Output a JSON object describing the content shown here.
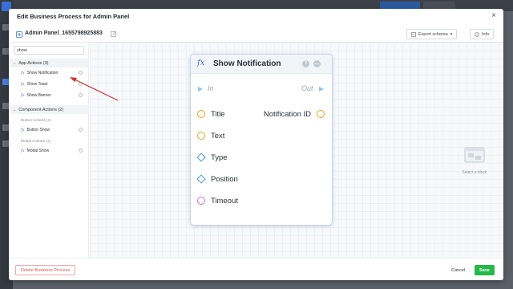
{
  "modal": {
    "title": "Edit Business Process for Admin Panel",
    "close_icon": "×"
  },
  "subheader": {
    "process_name": "Admin Panel_1655798925883",
    "export_label": "Export schema",
    "info_label": "Info"
  },
  "search": {
    "value": "show"
  },
  "left_panel": {
    "app_actions": {
      "label": "App Actions (3)",
      "items": [
        "Show Notification",
        "Show Toast",
        "Show Banner"
      ]
    },
    "component_actions": {
      "label": "Component Actions (2)",
      "button_actions_label": "Button Actions (1)",
      "button_items": [
        "Button Show"
      ],
      "modal_actions_label": "Modal Actions (1)",
      "modal_items": [
        "Modal Show"
      ]
    }
  },
  "node": {
    "fx": "fx",
    "title": "Show Notification",
    "in_label": "In",
    "out_label": "Out",
    "inputs": [
      {
        "label": "Title",
        "shape": "circle",
        "color": "#e5a31a"
      },
      {
        "label": "Text",
        "shape": "circle",
        "color": "#e5a31a"
      },
      {
        "label": "Type",
        "shape": "diamond",
        "color": "#4a95d6"
      },
      {
        "label": "Position",
        "shape": "diamond",
        "color": "#4a95d6"
      },
      {
        "label": "Timeout",
        "shape": "circle",
        "color": "#d26bd0"
      }
    ],
    "output": {
      "label": "Notification ID",
      "color": "#e5a31a"
    }
  },
  "empty_state": {
    "text": "Select a block"
  },
  "footer": {
    "delete_label": "Delete Business Process",
    "cancel_label": "Cancel",
    "save_label": "Save"
  },
  "colors": {
    "accent": "#3a6fd8",
    "save": "#27b84a",
    "danger": "#d9534f",
    "annotation": "#d32f2f"
  }
}
